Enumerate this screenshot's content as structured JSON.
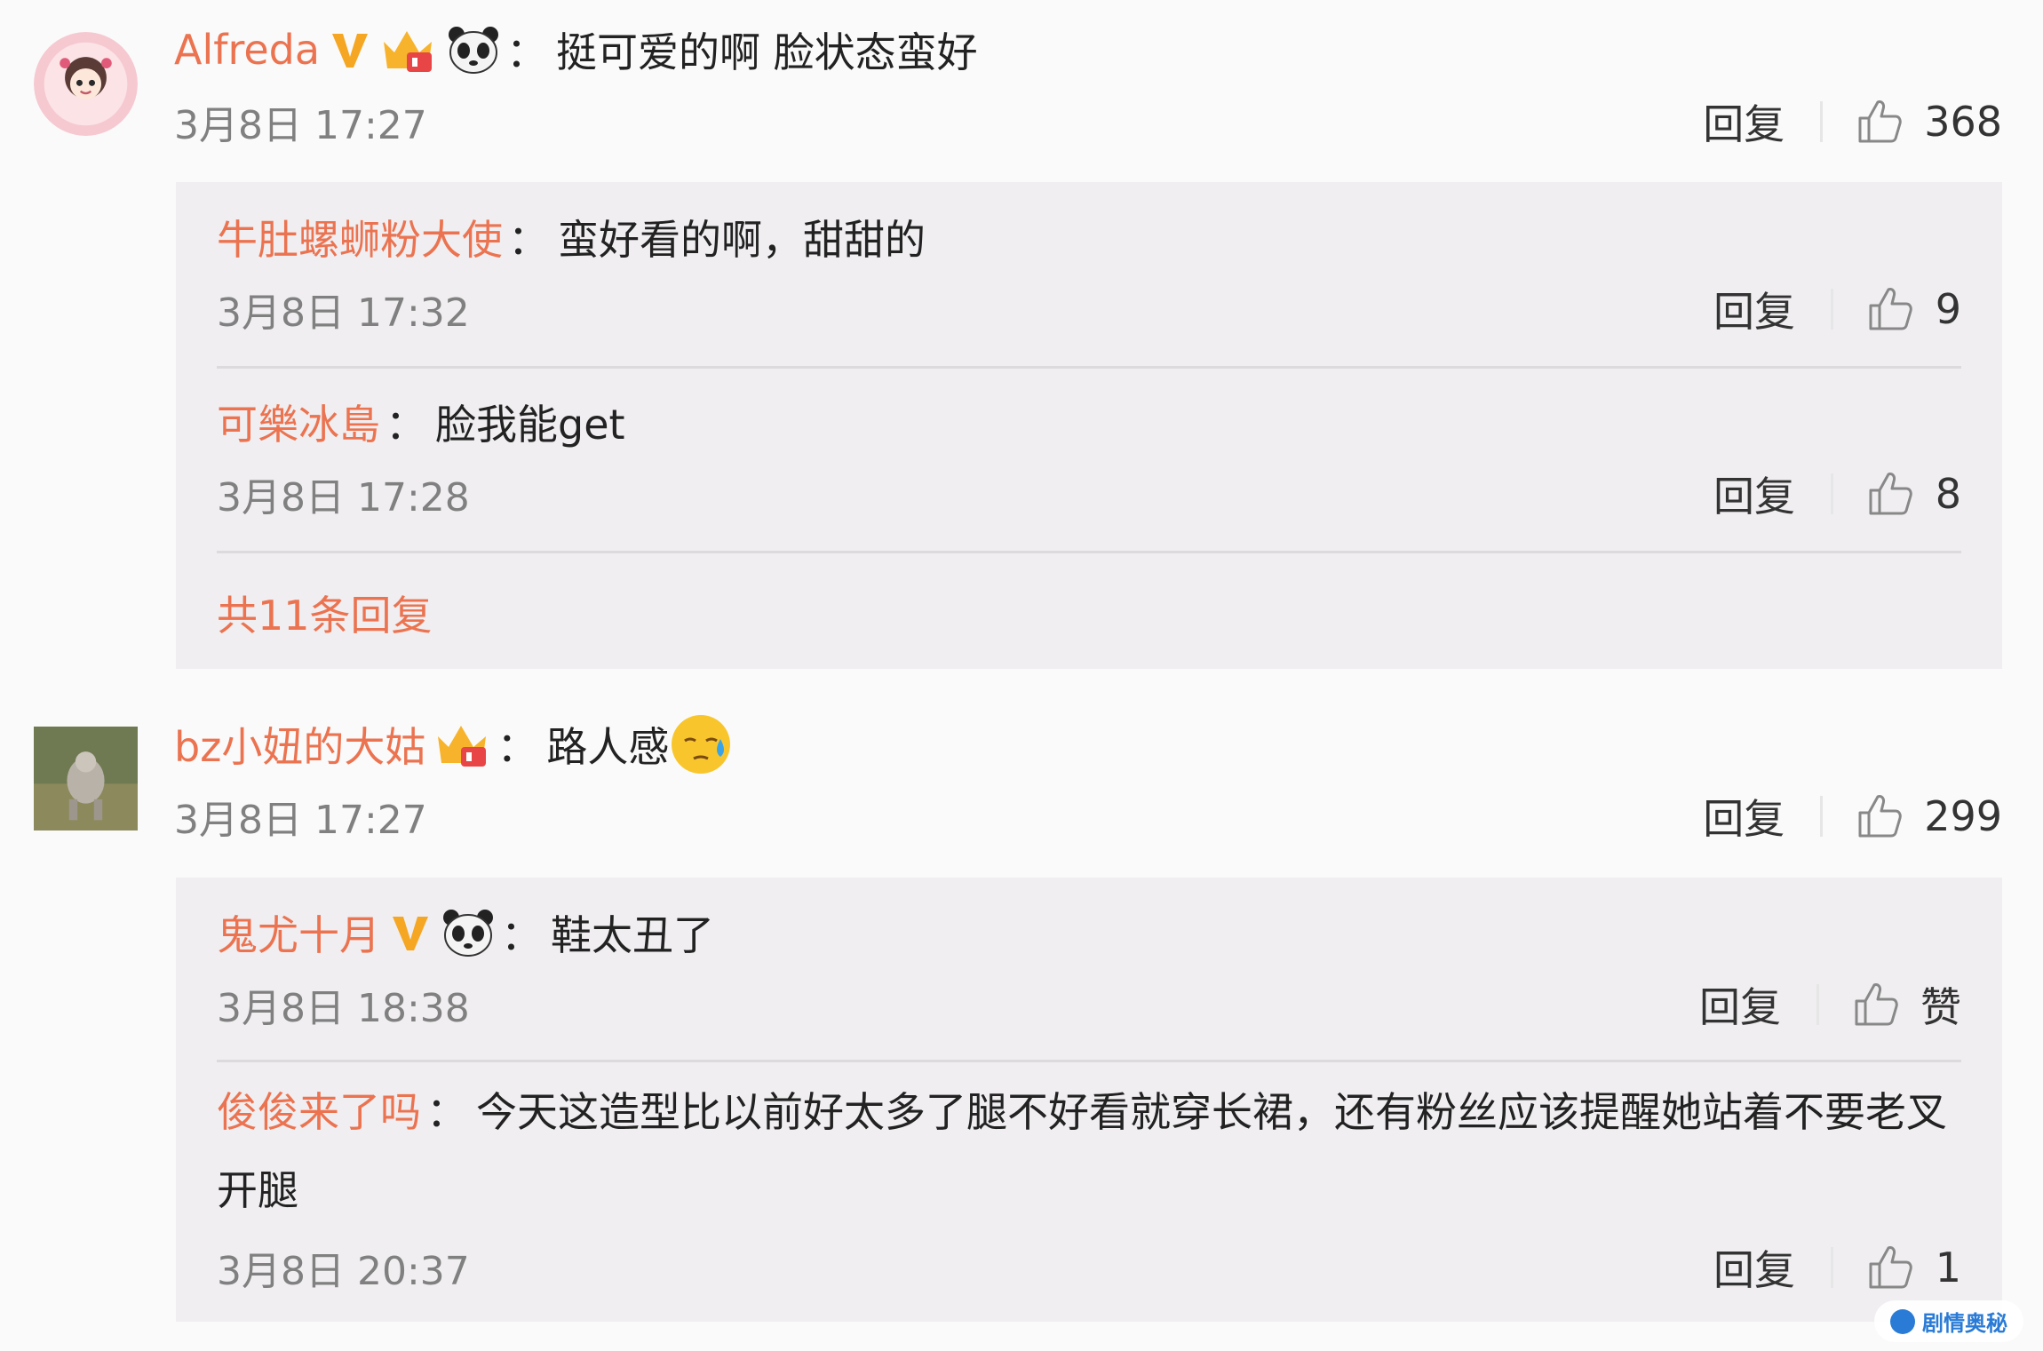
{
  "comments": [
    {
      "user": "Alfreda",
      "text": "挺可爱的啊 脸状态蛮好",
      "time": "3月8日 17:27",
      "reply_label": "回复",
      "likes": "368",
      "avatar_color": "#f4c6cf"
    },
    {
      "user": "bz小妞的大姑",
      "text": "路人感",
      "time": "3月8日 17:27",
      "reply_label": "回复",
      "likes": "299",
      "avatar_color": "#6d7a54"
    }
  ],
  "replies1": [
    {
      "user": "牛肚螺蛳粉大使",
      "text": "蛮好看的啊，甜甜的",
      "time": "3月8日 17:32",
      "reply_label": "回复",
      "likes": "9"
    },
    {
      "user": "可樂冰島",
      "text": "脸我能get",
      "time": "3月8日 17:28",
      "reply_label": "回复",
      "likes": "8"
    }
  ],
  "replies1_more": "共11条回复",
  "replies2": [
    {
      "user": "鬼尤十月",
      "text": "鞋太丑了",
      "time": "3月8日 18:38",
      "reply_label": "回复",
      "likes": "赞"
    },
    {
      "user": "俊俊来了吗",
      "text": "今天这造型比以前好太多了腿不好看就穿长裙，还有粉丝应该提醒她站着不要老叉开腿",
      "time": "3月8日 20:37",
      "reply_label": "回复",
      "likes": "1"
    }
  ],
  "colon": "：",
  "watermark": "剧情奥秘",
  "colors": {
    "username": "#eb7350",
    "reply_bg": "#f0eef1",
    "meta": "#808080"
  },
  "icons": [
    "verified-v-icon",
    "crown-badge-icon",
    "panda-emoji-icon",
    "sweat-emoji-icon",
    "thumbs-up-icon"
  ]
}
